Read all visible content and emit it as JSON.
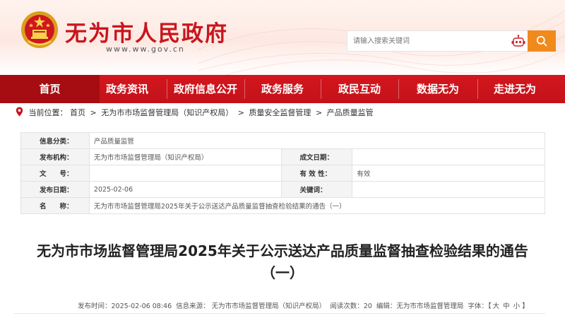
{
  "header": {
    "site_name": "无为市人民政府",
    "site_url": "www.ww.gov.cn",
    "search_placeholder": "请输入搜索关键词"
  },
  "colors": {
    "brand_red": "#c8161d",
    "search_orange": "#f08a1d"
  },
  "nav": [
    {
      "label": "首页"
    },
    {
      "label": "政务资讯"
    },
    {
      "label": "政府信息公开"
    },
    {
      "label": "政务服务"
    },
    {
      "label": "政民互动"
    },
    {
      "label": "数据无为"
    },
    {
      "label": "走进无为"
    }
  ],
  "breadcrumb": {
    "prefix": "当前位置：",
    "items": [
      "首页",
      "无为市市场监督管理局（知识产权局）",
      "质量安全监督管理",
      "产品质量监管"
    ],
    "separator": ">"
  },
  "info": {
    "category_label": "信息分类：",
    "category_value": "产品质量监管",
    "publisher_label": "发布机构：",
    "publisher_value": "无为市市场监督管理局（知识产权局）",
    "created_label": "成文日期：",
    "created_value": "",
    "docno_label": "文　　号：",
    "docno_value": "",
    "validity_label": "有 效 性：",
    "validity_value": "有效",
    "date_label": "发布日期：",
    "date_value": "2025-02-06",
    "keywords_label": "关键词：",
    "keywords_value": "",
    "name_label": "名　　称：",
    "name_value": "无为市市场监督管理局2025年关于公示送达产品质量监督抽查检验结果的通告（一）"
  },
  "article": {
    "title_line1": "无为市市场监督管理局2025年关于公示送达产品质量监督抽查检验结果的通告",
    "title_line2": "（一）"
  },
  "meta": {
    "publish_time": "发布时间：2025-02-06 08:46",
    "source": "信息来源：  无为市市场监督管理局（知识产权局）",
    "views": "阅读次数：20",
    "editor": "编辑：无为市市场监督管理局",
    "font_label": "字体：【",
    "font_large": "大",
    "font_medium": "中",
    "font_small": "小",
    "font_close": "】"
  }
}
